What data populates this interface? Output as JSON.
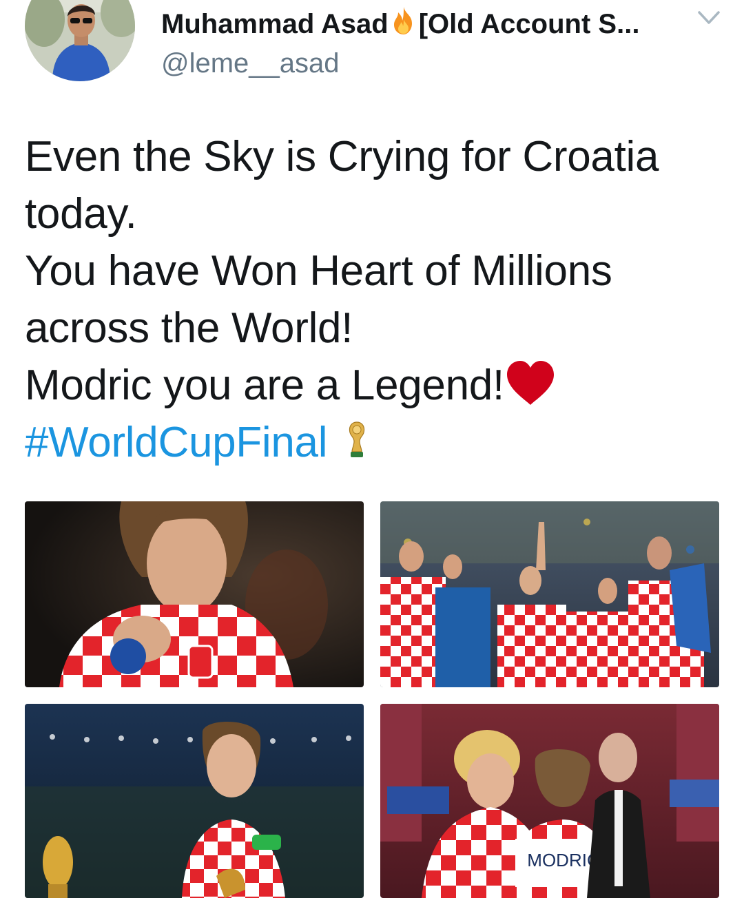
{
  "tweet": {
    "author": {
      "display_name": "Muhammad Asad",
      "display_name_suffix": "[Old Account S...",
      "handle": "@leme__asad",
      "avatar_icon": "profile-avatar"
    },
    "text_lines": [
      "Even the Sky is Crying for Croatia",
      "today.",
      "You have Won Heart of Millions",
      "across the World!",
      "Modric you are a Legend!"
    ],
    "hashtag": "#WorldCupFinal",
    "emojis": [
      "fire-icon",
      "red-heart-icon",
      "world-cup-trophy-icon"
    ],
    "media": [
      {
        "alt": "modric-crying-photo"
      },
      {
        "alt": "croatia-team-waving-photo"
      },
      {
        "alt": "modric-world-cup-photo"
      },
      {
        "alt": "president-embracing-modric-photo",
        "jersey_text": "MODRIĆ"
      }
    ]
  },
  "colors": {
    "text": "#14171a",
    "secondary": "#657786",
    "link": "#1b95e0",
    "heart": "#d0021b",
    "croatia_red": "#e3242b"
  }
}
